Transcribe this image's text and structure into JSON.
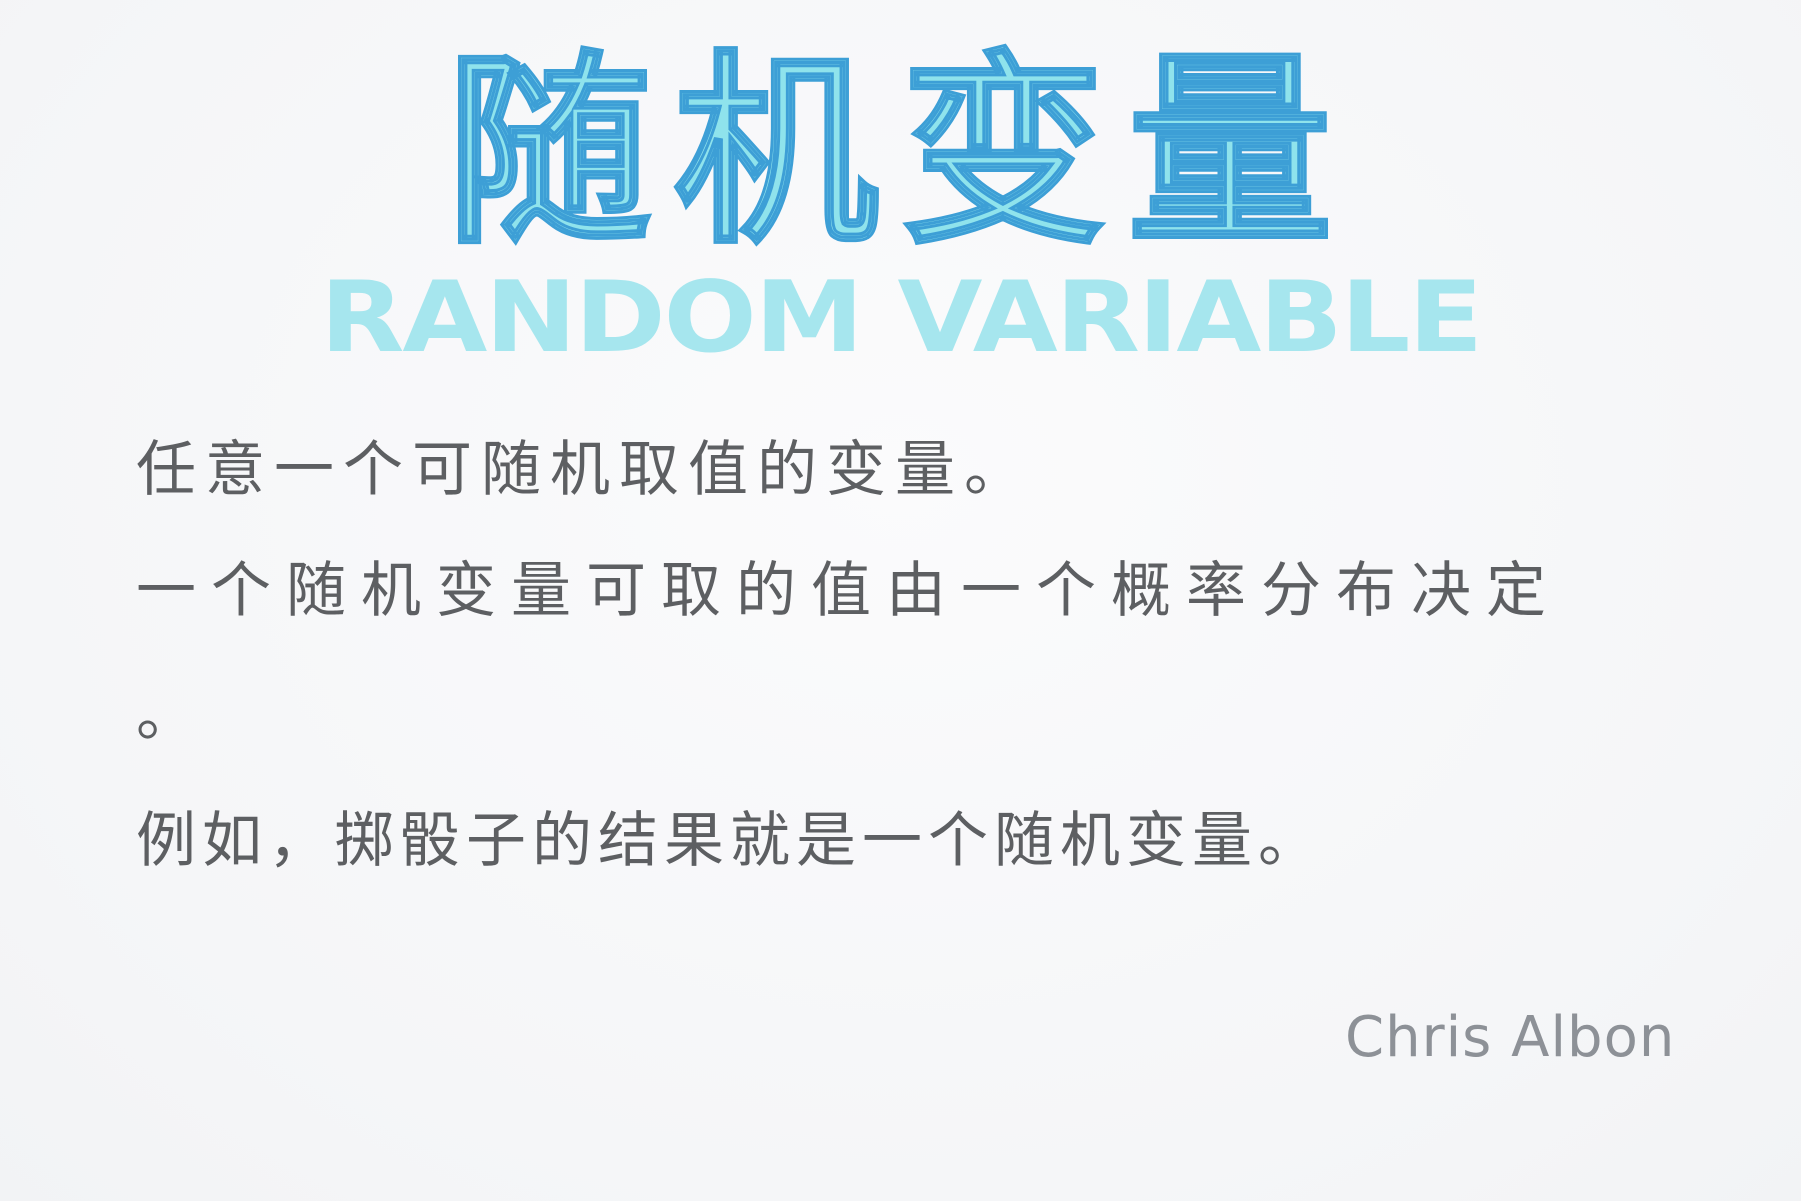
{
  "title": {
    "chinese": "随机变量",
    "english": "RANDOM VARIABLE"
  },
  "body": {
    "lines": [
      "任意一个可随机取值的变量。",
      "一个随机变量可取的值由一个概率分布决定",
      "。",
      "例如，掷骰子的结果就是一个随机变量。"
    ]
  },
  "signature": "Chris Albon",
  "colors": {
    "title_fill": "#8fe3ec",
    "title_outline": "#3d9fd6",
    "subtitle": "#a6e6ee",
    "body_text": "#5d5f62",
    "signature": "#8d9197",
    "background": "#f7f8fa"
  }
}
